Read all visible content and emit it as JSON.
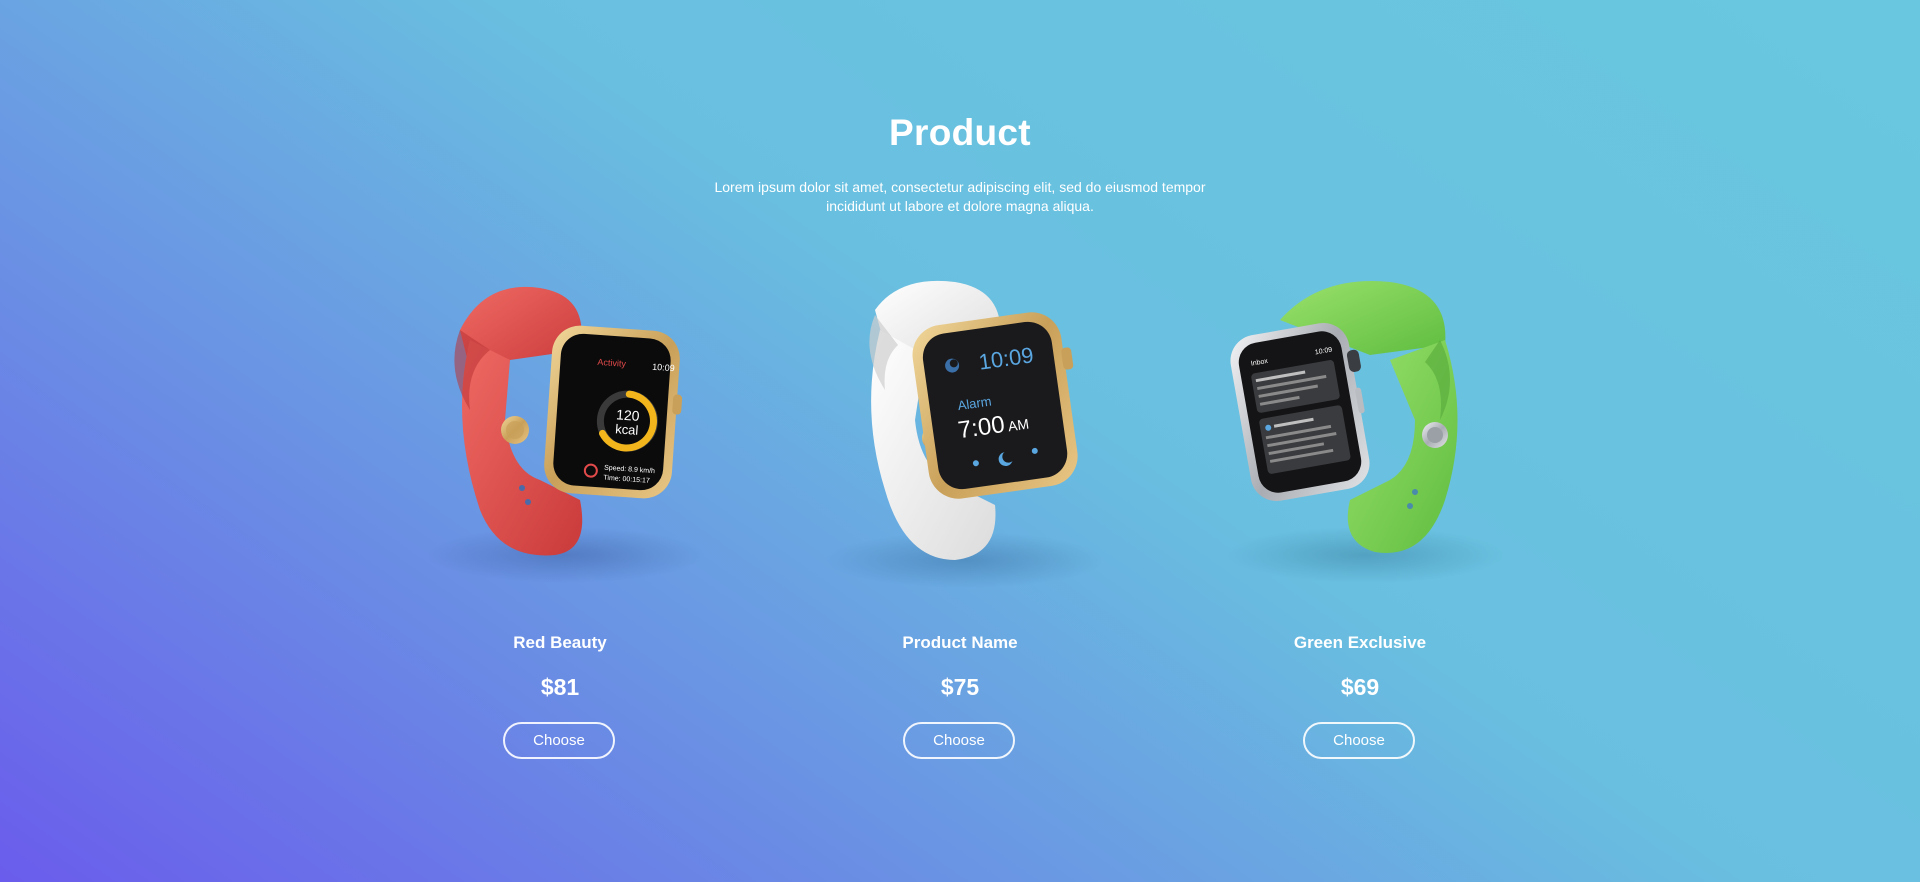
{
  "header": {
    "title": "Product",
    "subtitle_line1": "Lorem ipsum dolor sit amet, consectetur adipiscing elit, sed do eiusmod tempor",
    "subtitle_line2": "incididunt ut labore et dolore magna aliqua."
  },
  "products": [
    {
      "name": "Red Beauty",
      "price": "$81",
      "button_label": "Choose",
      "band_color": "#e2504d",
      "case_color": "#d8b36a",
      "screen": {
        "app": "Activity",
        "time": "10:09",
        "value": "120",
        "unit": "kcal",
        "speed": "Speed: 8.9 km/h",
        "elapsed": "Time: 00:15:17"
      }
    },
    {
      "name": "Product Name",
      "price": "$75",
      "button_label": "Choose",
      "band_color": "#f2f2f2",
      "case_color": "#d8b36a",
      "screen": {
        "time": "10:09",
        "label": "Alarm",
        "alarm_time": "7:00",
        "ampm": "AM"
      }
    },
    {
      "name": "Green Exclusive",
      "price": "$69",
      "button_label": "Choose",
      "band_color": "#7fd45a",
      "case_color": "#c9ccd1",
      "screen": {
        "app": "Inbox",
        "time": "10:09"
      }
    }
  ]
}
